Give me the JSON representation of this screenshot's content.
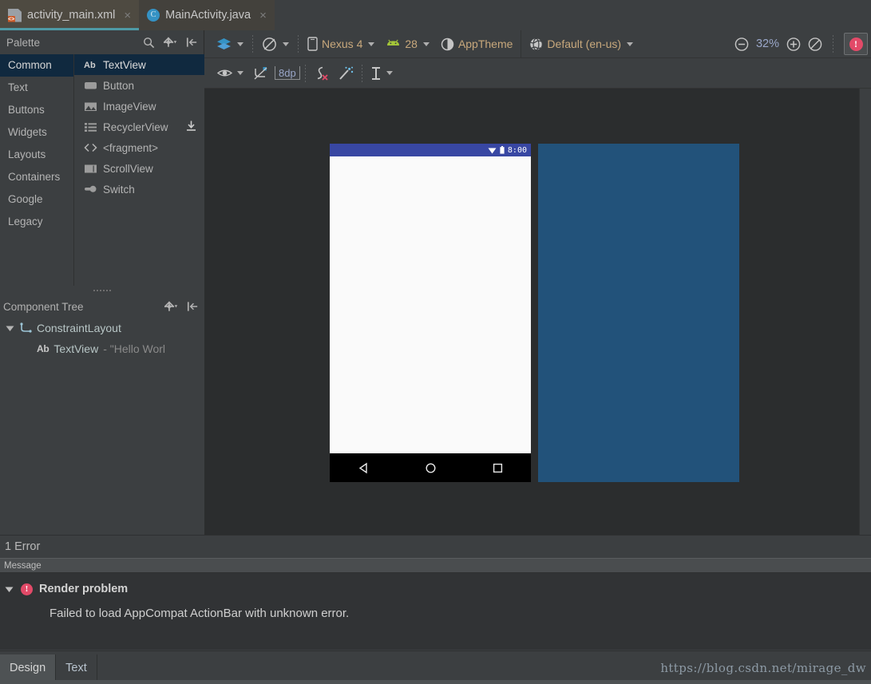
{
  "editor_tabs": [
    {
      "label": "activity_main.xml",
      "icon": "xml-file-icon",
      "active": true,
      "close": "×"
    },
    {
      "label": "MainActivity.java",
      "icon": "java-class-icon",
      "active": false,
      "close": "×"
    }
  ],
  "palette": {
    "title": "Palette",
    "tools": [
      {
        "name": "search-icon"
      },
      {
        "name": "gear-icon"
      },
      {
        "name": "collapse-panel-icon"
      }
    ],
    "categories": [
      {
        "label": "Common",
        "selected": true
      },
      {
        "label": "Text",
        "selected": false
      },
      {
        "label": "Buttons",
        "selected": false
      },
      {
        "label": "Widgets",
        "selected": false
      },
      {
        "label": "Layouts",
        "selected": false
      },
      {
        "label": "Containers",
        "selected": false
      },
      {
        "label": "Google",
        "selected": false
      },
      {
        "label": "Legacy",
        "selected": false
      }
    ],
    "items": [
      {
        "label": "TextView",
        "icon": "textview-icon",
        "selected": true,
        "download": false
      },
      {
        "label": "Button",
        "icon": "button-icon",
        "selected": false,
        "download": false
      },
      {
        "label": "ImageView",
        "icon": "imageview-icon",
        "selected": false,
        "download": false
      },
      {
        "label": "RecyclerView",
        "icon": "recyclerview-icon",
        "selected": false,
        "download": true
      },
      {
        "label": "<fragment>",
        "icon": "fragment-icon",
        "selected": false,
        "download": false
      },
      {
        "label": "ScrollView",
        "icon": "scrollview-icon",
        "selected": false,
        "download": false
      },
      {
        "label": "Switch",
        "icon": "switch-icon",
        "selected": false,
        "download": false
      }
    ]
  },
  "component_tree": {
    "title": "Component Tree",
    "tools": [
      {
        "name": "gear-icon"
      },
      {
        "name": "collapse-panel-icon"
      }
    ],
    "root": {
      "label": "ConstraintLayout",
      "icon": "constraintlayout-icon",
      "expanded": true
    },
    "child": {
      "tag": "Ab",
      "label": "TextView",
      "detail": "- \"Hello Worl"
    }
  },
  "design_toolbar": {
    "design_mode": {
      "label": "",
      "icon": "layers-icon"
    },
    "orientation": {
      "label": "",
      "icon": "rotate-icon"
    },
    "device": {
      "label": "Nexus 4",
      "icon": "phone-icon"
    },
    "api_level": {
      "label": "28",
      "icon": "android-icon"
    },
    "theme": {
      "label": "AppTheme",
      "icon": "theme-contrast-icon"
    },
    "locale": {
      "label": "Default (en-us)",
      "icon": "globe-icon"
    },
    "zoom_out": "zoom-out-icon",
    "zoom_level": "32%",
    "zoom_in": "zoom-in-icon",
    "zoom_fit": "zoom-fit-icon",
    "error_badge": "error-icon"
  },
  "constraint_toolbar": {
    "view_options": {
      "icon": "eye-icon"
    },
    "autoconnect": {
      "icon": "autoconnect-off-icon"
    },
    "default_margin": "8dp",
    "clear_constraints": {
      "icon": "clear-constraints-icon"
    },
    "infer_constraints": {
      "icon": "magic-wand-icon"
    },
    "guidelines": {
      "icon": "guideline-icon"
    }
  },
  "preview": {
    "status_bar": {
      "time": "8:00",
      "wifi": "wifi-icon",
      "battery": "battery-icon"
    },
    "nav_bar": {
      "back": "back-triangle-icon",
      "home": "home-circle-icon",
      "recents": "recents-square-icon"
    },
    "device_bg": "#fafafa",
    "status_bg": "#3847a3",
    "blueprint_bg": "#22527a"
  },
  "error_panel": {
    "summary": "1 Error",
    "column_header": "Message",
    "problem_title": "Render problem",
    "problem_detail": "Failed to load AppCompat ActionBar with unknown error.",
    "expanded": true,
    "severity_icon": "error-icon",
    "accent": "#e24a68"
  },
  "bottom_bar": {
    "tabs": [
      {
        "label": "Design",
        "selected": true
      },
      {
        "label": "Text",
        "selected": false
      }
    ],
    "watermark": "https://blog.csdn.net/mirage_dw"
  }
}
